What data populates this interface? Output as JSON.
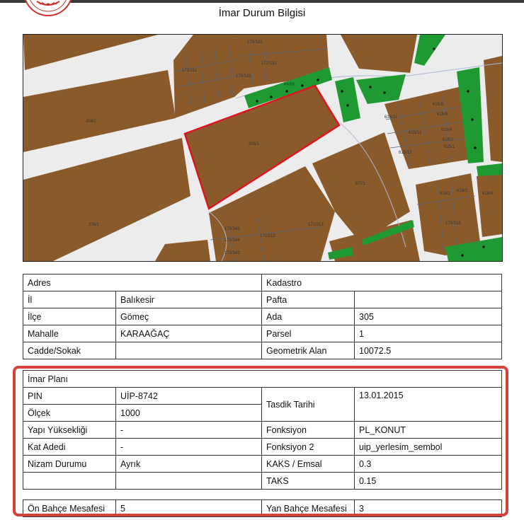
{
  "document": {
    "title": "İmar Durum Bilgisi"
  },
  "map": {
    "labels": [
      "304/1",
      "305/1",
      "306/1",
      "307/1",
      "172/111",
      "172/132",
      "172/131",
      "172/133",
      "172/212",
      "172/213",
      "172/216",
      "172/342",
      "172/343",
      "172/344",
      "615/12",
      "615/13",
      "615/8",
      "615/9",
      "615/4",
      "615/2",
      "615/1",
      "615/11",
      "618/2",
      "618/3",
      "618/4",
      "PARK"
    ],
    "colors": {
      "parcel": "#8b5a2b",
      "park": "#1f9a32",
      "road": "#ececec",
      "selected": "#e0141e"
    }
  },
  "address_table": {
    "header_left": "Adres",
    "header_right": "Kadastro",
    "rows": [
      {
        "k1": "İl",
        "v1": "Balıkesir",
        "k2": "Pafta",
        "v2": ""
      },
      {
        "k1": "İlçe",
        "v1": "Gömeç",
        "k2": "Ada",
        "v2": "305"
      },
      {
        "k1": "Mahalle",
        "v1": "KARAAĞAÇ",
        "k2": "Parsel",
        "v2": "1"
      },
      {
        "k1": "Cadde/Sokak",
        "v1": "",
        "k2": "Geometrik Alan",
        "v2": "10072.5"
      }
    ]
  },
  "plan_table": {
    "header": "İmar Planı",
    "pin_label": "PIN",
    "pin_value": "UİP-8742",
    "scale_label": "Ölçek",
    "scale_value": "1000",
    "approval_label": "Tasdik Tarihi",
    "approval_value": "13.01.2015",
    "rows": [
      {
        "k1": "Yapı Yüksekliği",
        "v1": "-",
        "k2": "Fonksiyon",
        "v2": "PL_KONUT"
      },
      {
        "k1": "Kat Adedi",
        "v1": "-",
        "k2": "Fonksiyon 2",
        "v2": "uip_yerlesim_sembol"
      },
      {
        "k1": "Nizam Durumu",
        "v1": "Ayrık",
        "k2": "KAKS / Emsal",
        "v2": "0.3"
      },
      {
        "k1": "",
        "v1": "",
        "k2": "TAKS",
        "v2": "0.15"
      }
    ]
  },
  "setback_table": {
    "front_label": "Ön Bahçe Mesafesi",
    "front_value": "5",
    "side_label": "Yan Bahçe Mesafesi",
    "side_value": "3"
  }
}
